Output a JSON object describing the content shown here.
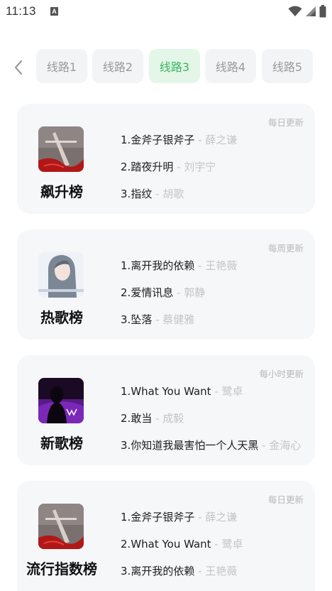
{
  "status": {
    "time": "11:13",
    "a_icon_letter": "A"
  },
  "tabs": [
    {
      "label": "线路1",
      "active": false
    },
    {
      "label": "线路2",
      "active": false
    },
    {
      "label": "线路3",
      "active": true
    },
    {
      "label": "线路4",
      "active": false
    },
    {
      "label": "线路5",
      "active": false
    }
  ],
  "charts": [
    {
      "name": "飙升榜",
      "update": "每日更新",
      "songs": [
        {
          "rank": "1.",
          "title": "金斧子银斧子",
          "artist": " - 薛之谦"
        },
        {
          "rank": "2.",
          "title": "踏夜升明",
          "artist": " - 刘宇宁"
        },
        {
          "rank": "3.",
          "title": "指纹",
          "artist": " - 胡歌"
        }
      ]
    },
    {
      "name": "热歌榜",
      "update": "每周更新",
      "songs": [
        {
          "rank": "1.",
          "title": "离开我的依赖",
          "artist": " - 王艳薇"
        },
        {
          "rank": "2.",
          "title": "爱情讯息",
          "artist": " - 郭静"
        },
        {
          "rank": "3.",
          "title": "坠落",
          "artist": " - 蔡健雅"
        }
      ]
    },
    {
      "name": "新歌榜",
      "update": "每小时更新",
      "songs": [
        {
          "rank": "1.",
          "title": "What You Want",
          "artist": " - 鹭卓"
        },
        {
          "rank": "2.",
          "title": "敢当",
          "artist": " - 成毅"
        },
        {
          "rank": "3.",
          "title": "你知道我最害怕一个人天黑",
          "artist": " - 金海心"
        }
      ]
    },
    {
      "name": "流行指数榜",
      "update": "每日更新",
      "songs": [
        {
          "rank": "1.",
          "title": "金斧子银斧子",
          "artist": " - 薛之谦"
        },
        {
          "rank": "2.",
          "title": "What You Want",
          "artist": " - 鹭卓"
        },
        {
          "rank": "3.",
          "title": "离开我的依赖",
          "artist": " - 王艳薇"
        }
      ]
    }
  ],
  "colors": {
    "accent": "#38b561",
    "tab_active_bg": "#e3f6e8",
    "card_bg": "#f6f7f9",
    "muted": "#c4c4c4"
  },
  "icons": {
    "back": "chevron-left-icon",
    "wifi": "wifi-icon",
    "signal": "signal-icon",
    "battery": "battery-icon"
  }
}
